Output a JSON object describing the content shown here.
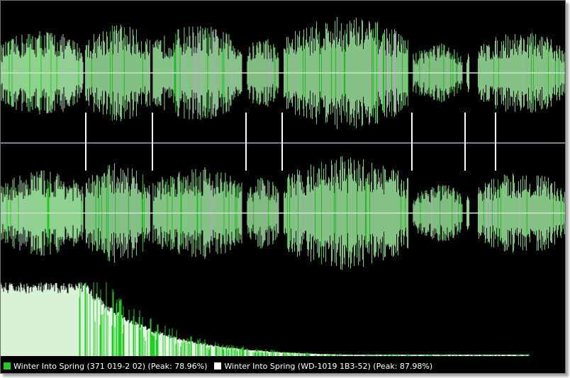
{
  "colors": {
    "background": "#000000",
    "series_a": "#22cc22",
    "series_b": "#ffffff",
    "wave_fill": "#8fd18f",
    "centerline": "#c8e6c8"
  },
  "legend": {
    "items": [
      {
        "label": "Winter Into Spring (371 019-2 02) (Peak: 78.96%)",
        "color": "#22cc22"
      },
      {
        "label": "Winter Into Spring (WD-1019 1B3-52) (Peak: 87.98%)",
        "color": "#ffffff"
      }
    ]
  },
  "markers": {
    "positions_fraction": [
      0.149,
      0.268,
      0.433,
      0.498,
      0.727,
      0.822,
      0.875
    ]
  },
  "waveform": {
    "segments": [
      {
        "start": 0.0,
        "end": 0.146,
        "level": 0.65
      },
      {
        "start": 0.15,
        "end": 0.265,
        "level": 0.75
      },
      {
        "start": 0.27,
        "end": 0.428,
        "level": 0.72
      },
      {
        "start": 0.437,
        "end": 0.493,
        "level": 0.55
      },
      {
        "start": 0.502,
        "end": 0.723,
        "level": 0.85
      },
      {
        "start": 0.731,
        "end": 0.818,
        "level": 0.45
      },
      {
        "start": 0.826,
        "end": 0.83,
        "level": 0.35
      },
      {
        "start": 0.846,
        "end": 1.0,
        "level": 0.62
      }
    ]
  }
}
